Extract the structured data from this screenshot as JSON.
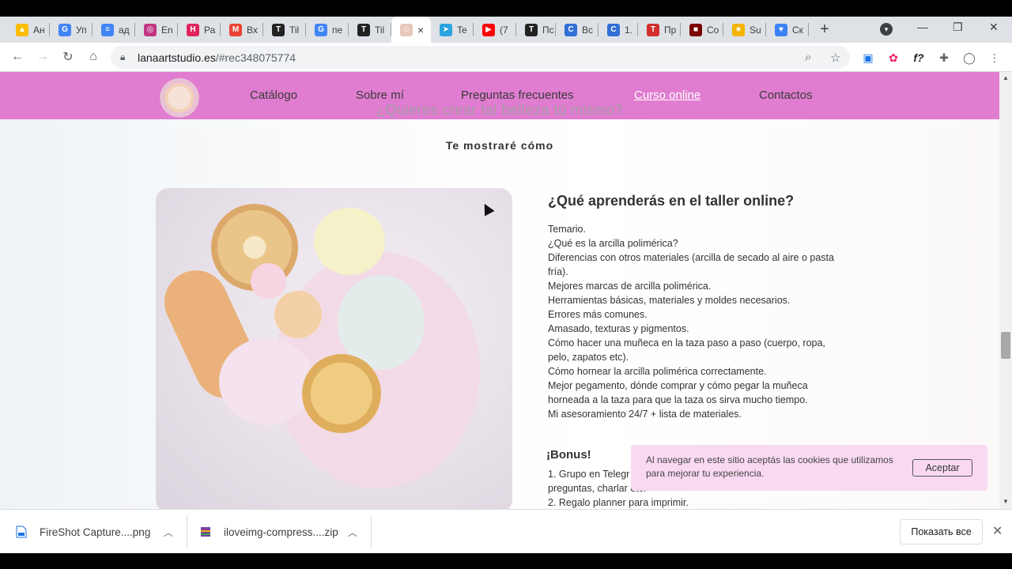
{
  "browser": {
    "tabs": [
      {
        "label": "Ан",
        "color": "#fbbc04",
        "glyph": "▲"
      },
      {
        "label": "Уп",
        "color": "#4285f4",
        "glyph": "G"
      },
      {
        "label": "ад",
        "color": "#4285f4",
        "glyph": "≡"
      },
      {
        "label": "En",
        "color": "#c13584",
        "glyph": "◎"
      },
      {
        "label": "Ра",
        "color": "#e0245e",
        "glyph": "H"
      },
      {
        "label": "Вх",
        "color": "#ea4335",
        "glyph": "M"
      },
      {
        "label": "Til",
        "color": "#222222",
        "glyph": "T"
      },
      {
        "label": "пе",
        "color": "#4285f4",
        "glyph": "G"
      },
      {
        "label": "Til",
        "color": "#222222",
        "glyph": "T"
      },
      {
        "label": "",
        "color": "#e8c8b8",
        "glyph": "☺",
        "active": true
      },
      {
        "label": "Te",
        "color": "#2aa3df",
        "glyph": "➤"
      },
      {
        "label": "(7",
        "color": "#ff0000",
        "glyph": "▶"
      },
      {
        "label": "Пс",
        "color": "#222222",
        "glyph": "T"
      },
      {
        "label": "Вс",
        "color": "#2f6fd6",
        "glyph": "C"
      },
      {
        "label": "1.",
        "color": "#2f6fd6",
        "glyph": "C"
      },
      {
        "label": "Пр",
        "color": "#d32f2f",
        "glyph": "ТАБ"
      },
      {
        "label": "Co",
        "color": "#7a0000",
        "glyph": "■"
      },
      {
        "label": "Su",
        "color": "#f4b400",
        "glyph": "★"
      },
      {
        "label": "Ск",
        "color": "#3b82f6",
        "glyph": "♥"
      }
    ],
    "new_tab": "+",
    "close_tab": "×",
    "url_host": "lanaartstudio.es",
    "url_path": "/#rec348075774",
    "search_icon": "search-icon",
    "bookmark_icon": "star-icon"
  },
  "site": {
    "nav": [
      "Catálogo",
      "Sobre mí",
      "Preguntas frecuentes",
      "Curso online",
      "Contactos"
    ],
    "nav_active": "Curso online",
    "subtitle": "¿Quieres crear tal belleza tú mismo?",
    "lead": "Te mostraré cómo",
    "section_title": "¿Qué aprenderás en el taller online?",
    "syllabus": [
      "Temario.",
      "¿Qué es la arcilla polimérica?",
      "Diferencias con otros materiales (arcilla de secado al aire o pasta fría).",
      "Mejores marcas de arcilla polimérica.",
      "Herramientas básicas, materiales y moldes necesarios.",
      "Errores más comunes.",
      "Amasado, texturas y pigmentos.",
      "Cómo hacer una muñeca en la taza paso a paso (cuerpo, ropa, pelo, zapatos etc).",
      "Cómo hornear la arcilla polimérica correctamente.",
      "Mejor pegamento, dónde comprar y cómo pegar la muñeca horneada a la taza para que la taza os sirva mucho tiempo.",
      "Mi asesoramiento 24/7 + lista de materiales."
    ],
    "bonus_title": "¡Bonus!",
    "bonus": [
      "1. Grupo en Telegr",
      "preguntas, charlar etc.",
      "2. Regalo planner para imprimir."
    ]
  },
  "cookie": {
    "text": "Al navegar en este sitio aceptás las cookies que utilizamos para mejorar tu experiencia.",
    "button": "Aceptar"
  },
  "downloads": {
    "items": [
      {
        "name": "FireShot Capture....png",
        "icon_color": "#1a73e8"
      },
      {
        "name": "iloveimg-compress....zip",
        "icon_color": "#7b3fa0"
      }
    ],
    "show_all": "Показать все"
  },
  "colors": {
    "nav_bg": "#e07dd0",
    "nav_active": "#ffffff",
    "cookie_bg": "#f9d9f2"
  }
}
